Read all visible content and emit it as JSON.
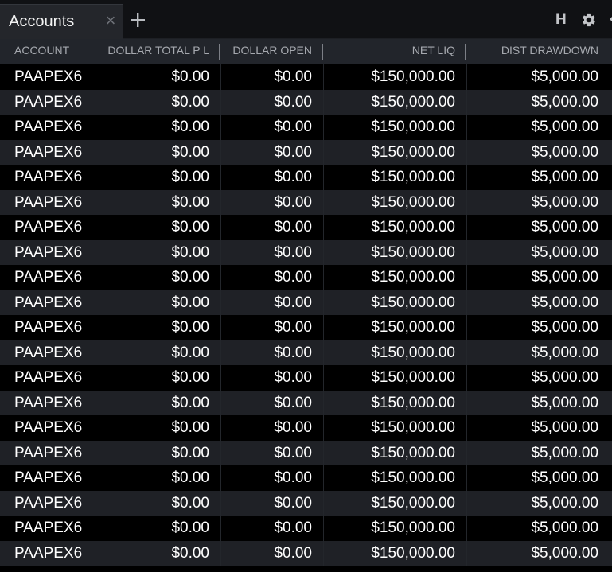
{
  "tab": {
    "title": "Accounts",
    "close_icon": "close-icon",
    "add_icon": "plus-icon"
  },
  "toolbar": {
    "h_label": "H",
    "gear_icon": "gear-icon",
    "pin_icon": "pin-icon"
  },
  "table": {
    "columns": [
      {
        "key": "account",
        "label": "ACCOUNT"
      },
      {
        "key": "dollar_total_pl",
        "label": "DOLLAR TOTAL P L"
      },
      {
        "key": "dollar_open",
        "label": "DOLLAR OPEN"
      },
      {
        "key": "net_liq",
        "label": "NET LIQ"
      },
      {
        "key": "dist_drawdown",
        "label": "DIST DRAWDOWN"
      }
    ],
    "rows": [
      {
        "account": "PAAPEX6",
        "dollar_total_pl": "$0.00",
        "dollar_open": "$0.00",
        "net_liq": "$150,000.00",
        "dist_drawdown": "$5,000.00"
      },
      {
        "account": "PAAPEX6",
        "dollar_total_pl": "$0.00",
        "dollar_open": "$0.00",
        "net_liq": "$150,000.00",
        "dist_drawdown": "$5,000.00"
      },
      {
        "account": "PAAPEX6",
        "dollar_total_pl": "$0.00",
        "dollar_open": "$0.00",
        "net_liq": "$150,000.00",
        "dist_drawdown": "$5,000.00"
      },
      {
        "account": "PAAPEX6",
        "dollar_total_pl": "$0.00",
        "dollar_open": "$0.00",
        "net_liq": "$150,000.00",
        "dist_drawdown": "$5,000.00"
      },
      {
        "account": "PAAPEX6",
        "dollar_total_pl": "$0.00",
        "dollar_open": "$0.00",
        "net_liq": "$150,000.00",
        "dist_drawdown": "$5,000.00"
      },
      {
        "account": "PAAPEX6",
        "dollar_total_pl": "$0.00",
        "dollar_open": "$0.00",
        "net_liq": "$150,000.00",
        "dist_drawdown": "$5,000.00"
      },
      {
        "account": "PAAPEX6",
        "dollar_total_pl": "$0.00",
        "dollar_open": "$0.00",
        "net_liq": "$150,000.00",
        "dist_drawdown": "$5,000.00"
      },
      {
        "account": "PAAPEX6",
        "dollar_total_pl": "$0.00",
        "dollar_open": "$0.00",
        "net_liq": "$150,000.00",
        "dist_drawdown": "$5,000.00"
      },
      {
        "account": "PAAPEX6",
        "dollar_total_pl": "$0.00",
        "dollar_open": "$0.00",
        "net_liq": "$150,000.00",
        "dist_drawdown": "$5,000.00"
      },
      {
        "account": "PAAPEX6",
        "dollar_total_pl": "$0.00",
        "dollar_open": "$0.00",
        "net_liq": "$150,000.00",
        "dist_drawdown": "$5,000.00"
      },
      {
        "account": "PAAPEX6",
        "dollar_total_pl": "$0.00",
        "dollar_open": "$0.00",
        "net_liq": "$150,000.00",
        "dist_drawdown": "$5,000.00"
      },
      {
        "account": "PAAPEX6",
        "dollar_total_pl": "$0.00",
        "dollar_open": "$0.00",
        "net_liq": "$150,000.00",
        "dist_drawdown": "$5,000.00"
      },
      {
        "account": "PAAPEX6",
        "dollar_total_pl": "$0.00",
        "dollar_open": "$0.00",
        "net_liq": "$150,000.00",
        "dist_drawdown": "$5,000.00"
      },
      {
        "account": "PAAPEX6",
        "dollar_total_pl": "$0.00",
        "dollar_open": "$0.00",
        "net_liq": "$150,000.00",
        "dist_drawdown": "$5,000.00"
      },
      {
        "account": "PAAPEX6",
        "dollar_total_pl": "$0.00",
        "dollar_open": "$0.00",
        "net_liq": "$150,000.00",
        "dist_drawdown": "$5,000.00"
      },
      {
        "account": "PAAPEX6",
        "dollar_total_pl": "$0.00",
        "dollar_open": "$0.00",
        "net_liq": "$150,000.00",
        "dist_drawdown": "$5,000.00"
      },
      {
        "account": "PAAPEX6",
        "dollar_total_pl": "$0.00",
        "dollar_open": "$0.00",
        "net_liq": "$150,000.00",
        "dist_drawdown": "$5,000.00"
      },
      {
        "account": "PAAPEX6",
        "dollar_total_pl": "$0.00",
        "dollar_open": "$0.00",
        "net_liq": "$150,000.00",
        "dist_drawdown": "$5,000.00"
      },
      {
        "account": "PAAPEX6",
        "dollar_total_pl": "$0.00",
        "dollar_open": "$0.00",
        "net_liq": "$150,000.00",
        "dist_drawdown": "$5,000.00"
      },
      {
        "account": "PAAPEX6",
        "dollar_total_pl": "$0.00",
        "dollar_open": "$0.00",
        "net_liq": "$150,000.00",
        "dist_drawdown": "$5,000.00"
      }
    ]
  }
}
